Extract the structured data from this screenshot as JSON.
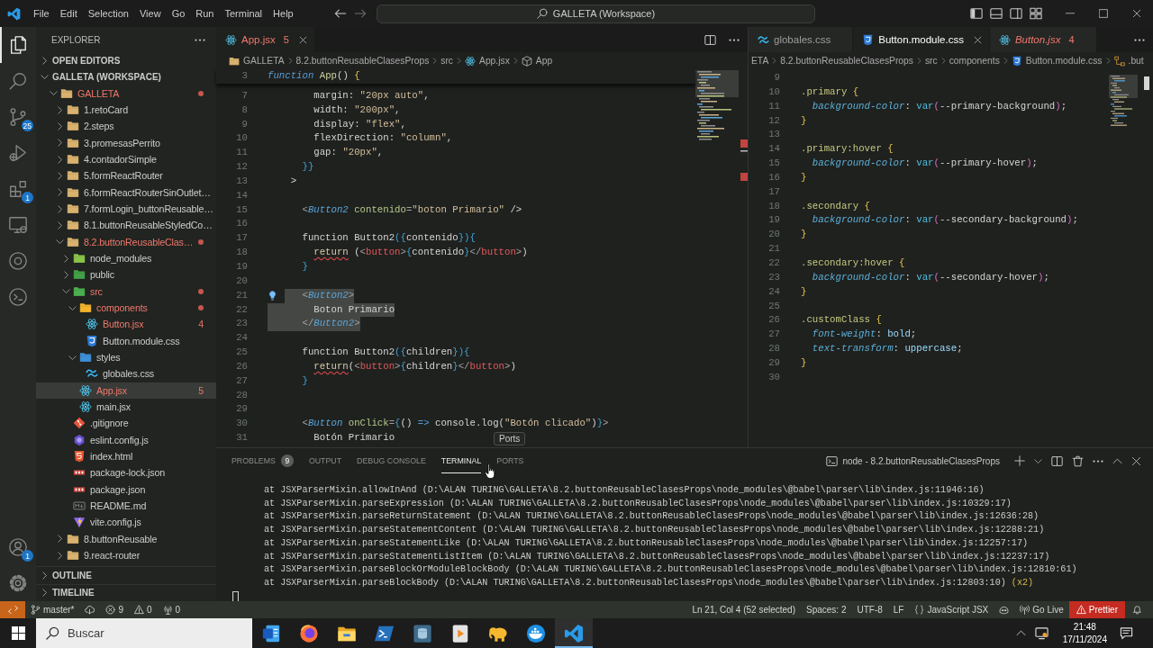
{
  "title_bar": {
    "menus": [
      "File",
      "Edit",
      "Selection",
      "View",
      "Go",
      "Run",
      "Terminal",
      "Help"
    ],
    "search": "GALLETA (Workspace)"
  },
  "activity_bar": {
    "top": [
      {
        "kind": "files",
        "selected": true
      },
      {
        "kind": "search",
        "selected": false
      },
      {
        "kind": "source-control",
        "selected": false,
        "badge": "25"
      },
      {
        "kind": "run-debug",
        "selected": false
      },
      {
        "kind": "extensions",
        "selected": false,
        "badge": "1"
      },
      {
        "kind": "remote",
        "selected": false
      },
      {
        "kind": "target",
        "selected": false
      },
      {
        "kind": "disc",
        "selected": false
      }
    ],
    "bottom": [
      {
        "kind": "account",
        "badge": "1"
      },
      {
        "kind": "settings"
      }
    ]
  },
  "sidebar": {
    "title": "EXPLORER",
    "sections": [
      {
        "label": "OPEN EDITORS",
        "expanded": false
      },
      {
        "label": "GALLETA (WORKSPACE)",
        "expanded": true,
        "tree": [
          {
            "label": "GALLETA",
            "kind": "folder-root",
            "expanded": true,
            "error": true,
            "selected": false,
            "children": [
              {
                "label": "1.retoCard",
                "kind": "folder",
                "expanded": false,
                "error": false,
                "selected": false
              },
              {
                "label": "2.steps",
                "kind": "folder",
                "expanded": false,
                "error": false,
                "selected": false
              },
              {
                "label": "3.promesasPerrito",
                "kind": "folder",
                "expanded": false,
                "error": false,
                "selected": false
              },
              {
                "label": "4.contadorSimple",
                "kind": "folder",
                "expanded": false,
                "error": false,
                "selected": false
              },
              {
                "label": "5.formReactRouter",
                "kind": "folder",
                "expanded": false,
                "error": false,
                "selected": false
              },
              {
                "label": "6.formReactRouterSinOutlet…",
                "kind": "folder",
                "expanded": false,
                "error": false,
                "selected": false
              },
              {
                "label": "7.formLogin_buttonReusable…",
                "kind": "folder",
                "expanded": false,
                "error": false,
                "selected": false
              },
              {
                "label": "8.1.buttonReusableStyledCo…",
                "kind": "folder",
                "expanded": false,
                "error": false,
                "selected": false
              },
              {
                "label": "8.2.buttonReusableClas…",
                "kind": "folder",
                "expanded": true,
                "error": true,
                "selected": false,
                "children": [
                  {
                    "label": "node_modules",
                    "kind": "folder-node",
                    "expanded": false,
                    "error": false,
                    "selected": false
                  },
                  {
                    "label": "public",
                    "kind": "folder-public",
                    "expanded": false,
                    "error": false,
                    "selected": false
                  },
                  {
                    "label": "src",
                    "kind": "folder-src",
                    "expanded": true,
                    "error": true,
                    "selected": false,
                    "children": [
                      {
                        "label": "components",
                        "kind": "folder-components",
                        "expanded": true,
                        "error": true,
                        "selected": false,
                        "children": [
                          {
                            "label": "Button.jsx",
                            "kind": "react",
                            "error": true,
                            "selected": false,
                            "badge": "4"
                          },
                          {
                            "label": "Button.module.css",
                            "kind": "css",
                            "error": false,
                            "selected": false
                          }
                        ]
                      },
                      {
                        "label": "styles",
                        "kind": "folder-styles",
                        "expanded": true,
                        "error": false,
                        "selected": false,
                        "children": [
                          {
                            "label": "globales.css",
                            "kind": "wave",
                            "error": false,
                            "selected": false
                          }
                        ]
                      },
                      {
                        "label": "App.jsx",
                        "kind": "react",
                        "error": true,
                        "selected": true,
                        "badge": "5"
                      },
                      {
                        "label": "main.jsx",
                        "kind": "react",
                        "error": false,
                        "selected": false
                      }
                    ]
                  },
                  {
                    "label": ".gitignore",
                    "kind": "git",
                    "error": false,
                    "selected": false
                  },
                  {
                    "label": "eslint.config.js",
                    "kind": "eslint",
                    "error": false,
                    "selected": false
                  },
                  {
                    "label": "index.html",
                    "kind": "html",
                    "error": false,
                    "selected": false
                  },
                  {
                    "label": "package-lock.json",
                    "kind": "json",
                    "error": false,
                    "selected": false
                  },
                  {
                    "label": "package.json",
                    "kind": "json",
                    "error": false,
                    "selected": false
                  },
                  {
                    "label": "README.md",
                    "kind": "markdown",
                    "error": false,
                    "selected": false
                  },
                  {
                    "label": "vite.config.js",
                    "kind": "vite",
                    "error": false,
                    "selected": false
                  }
                ]
              },
              {
                "label": "8.buttonReusable",
                "kind": "folder",
                "expanded": false,
                "error": false,
                "selected": false
              },
              {
                "label": "9.react-router",
                "kind": "folder",
                "expanded": false,
                "error": false,
                "selected": false
              }
            ]
          }
        ]
      },
      {
        "label": "OUTLINE",
        "expanded": false
      },
      {
        "label": "TIMELINE",
        "expanded": false
      }
    ]
  },
  "editors": [
    {
      "tabs": [
        {
          "label": "App.jsx",
          "kind": "react",
          "badge": "5",
          "error": true,
          "selected": true,
          "preview": false
        }
      ],
      "breadcrumbs": [
        {
          "label": "GALLETA",
          "kind": "folder"
        },
        {
          "label": "8.2.buttonReusableClasesProps",
          "kind": "plain"
        },
        {
          "label": "src",
          "kind": "plain"
        },
        {
          "label": "App.jsx",
          "kind": "react"
        },
        {
          "label": "App",
          "kind": "symbol"
        }
      ],
      "sticky_line": {
        "number": "3",
        "tokens": [
          {
            "kind": "kw",
            "text": "function"
          },
          {
            "kind": "fn",
            "text": " App"
          },
          {
            "kind": "text",
            "text": "() "
          },
          {
            "kind": "ybrace",
            "text": "{"
          }
        ]
      },
      "lines": [
        {
          "number": "7",
          "selected": false,
          "tokens": [
            {
              "kind": "text",
              "text": "        margin: "
            },
            {
              "kind": "str",
              "text": "\"20px auto\""
            },
            {
              "kind": "text",
              "text": ","
            }
          ]
        },
        {
          "number": "8",
          "selected": false,
          "tokens": [
            {
              "kind": "text",
              "text": "        width: "
            },
            {
              "kind": "str",
              "text": "\"200px\""
            },
            {
              "kind": "text",
              "text": ","
            }
          ]
        },
        {
          "number": "9",
          "selected": false,
          "tokens": [
            {
              "kind": "text",
              "text": "        display: "
            },
            {
              "kind": "str",
              "text": "\"flex\""
            },
            {
              "kind": "text",
              "text": ","
            }
          ]
        },
        {
          "number": "10",
          "selected": false,
          "tokens": [
            {
              "kind": "text",
              "text": "        flexDirection: "
            },
            {
              "kind": "str",
              "text": "\"column\""
            },
            {
              "kind": "text",
              "text": ","
            }
          ]
        },
        {
          "number": "11",
          "selected": false,
          "tokens": [
            {
              "kind": "text",
              "text": "        gap: "
            },
            {
              "kind": "str",
              "text": "\"20px\""
            },
            {
              "kind": "text",
              "text": ","
            }
          ]
        },
        {
          "number": "12",
          "selected": false,
          "tokens": [
            {
              "kind": "brace",
              "text": "      }}"
            }
          ]
        },
        {
          "number": "13",
          "selected": false,
          "tokens": [
            {
              "kind": "text",
              "text": "    >"
            }
          ]
        },
        {
          "number": "14",
          "selected": false
        },
        {
          "number": "15",
          "selected": false,
          "tokens": [
            {
              "kind": "punct",
              "text": "      <"
            },
            {
              "kind": "comp",
              "text": "Button2"
            },
            {
              "kind": "attr",
              "text": " contenido"
            },
            {
              "kind": "punct",
              "text": "="
            },
            {
              "kind": "str",
              "text": "\"boton Primario\""
            },
            {
              "kind": "text",
              "text": " />"
            }
          ]
        },
        {
          "number": "16",
          "selected": false
        },
        {
          "number": "17",
          "selected": false,
          "tokens": [
            {
              "kind": "text",
              "text": "      function Button2"
            },
            {
              "kind": "brace",
              "text": "({"
            },
            {
              "kind": "text",
              "text": "contenido"
            },
            {
              "kind": "brace",
              "text": "}){"
            }
          ]
        },
        {
          "number": "18",
          "selected": false,
          "tokens": [
            {
              "kind": "err",
              "text": "        return"
            },
            {
              "kind": "text",
              "text": " ("
            },
            {
              "kind": "punct",
              "text": "<"
            },
            {
              "kind": "tag",
              "text": "button"
            },
            {
              "kind": "punct",
              "text": ">"
            },
            {
              "kind": "brace",
              "text": "{"
            },
            {
              "kind": "text",
              "text": "contenido"
            },
            {
              "kind": "brace",
              "text": "}"
            },
            {
              "kind": "punct",
              "text": "</"
            },
            {
              "kind": "tag",
              "text": "button"
            },
            {
              "kind": "punct",
              "text": ">"
            },
            {
              "kind": "text",
              "text": ")"
            }
          ]
        },
        {
          "number": "19",
          "selected": false,
          "tokens": [
            {
              "kind": "brace",
              "text": "      }"
            }
          ]
        },
        {
          "number": "20",
          "selected": false
        },
        {
          "number": "21",
          "selected": true,
          "tokens": [
            {
              "kind": "punct",
              "text": "      <"
            },
            {
              "kind": "comp",
              "text": "Button2"
            },
            {
              "kind": "punct",
              "text": ">"
            }
          ]
        },
        {
          "number": "22",
          "selected": true,
          "tokens": [
            {
              "kind": "text",
              "text": "        Boton Primario"
            }
          ]
        },
        {
          "number": "23",
          "selected": true,
          "tokens": [
            {
              "kind": "punct",
              "text": "      </"
            },
            {
              "kind": "comp",
              "text": "Button2"
            },
            {
              "kind": "punct",
              "text": ">"
            }
          ]
        },
        {
          "number": "24",
          "selected": false
        },
        {
          "number": "25",
          "selected": false,
          "tokens": [
            {
              "kind": "text",
              "text": "      function Button2"
            },
            {
              "kind": "brace",
              "text": "({"
            },
            {
              "kind": "text",
              "text": "children"
            },
            {
              "kind": "brace",
              "text": "}){"
            }
          ]
        },
        {
          "number": "26",
          "selected": false,
          "tokens": [
            {
              "kind": "err",
              "text": "        return"
            },
            {
              "kind": "text",
              "text": "("
            },
            {
              "kind": "punct",
              "text": "<"
            },
            {
              "kind": "tag",
              "text": "button"
            },
            {
              "kind": "punct",
              "text": ">"
            },
            {
              "kind": "brace",
              "text": "{"
            },
            {
              "kind": "text",
              "text": "children"
            },
            {
              "kind": "brace",
              "text": "}"
            },
            {
              "kind": "punct",
              "text": "</"
            },
            {
              "kind": "tag",
              "text": "button"
            },
            {
              "kind": "punct",
              "text": ">"
            },
            {
              "kind": "text",
              "text": ")"
            }
          ]
        },
        {
          "number": "27",
          "selected": false,
          "tokens": [
            {
              "kind": "brace",
              "text": "      }"
            }
          ]
        },
        {
          "number": "28",
          "selected": false
        },
        {
          "number": "29",
          "selected": false
        },
        {
          "number": "30",
          "selected": false,
          "tokens": [
            {
              "kind": "punct",
              "text": "      <"
            },
            {
              "kind": "comp",
              "text": "Button"
            },
            {
              "kind": "attr",
              "text": " onClick"
            },
            {
              "kind": "punct",
              "text": "="
            },
            {
              "kind": "brace",
              "text": "{"
            },
            {
              "kind": "text",
              "text": "() "
            },
            {
              "kind": "op",
              "text": "=>"
            },
            {
              "kind": "text",
              "text": " console.log("
            },
            {
              "kind": "str",
              "text": "\"Botón clicado\""
            },
            {
              "kind": "text",
              "text": ")"
            },
            {
              "kind": "brace",
              "text": "}"
            },
            {
              "kind": "punct",
              "text": ">"
            }
          ]
        },
        {
          "number": "31",
          "selected": false,
          "tokens": [
            {
              "kind": "text",
              "text": "        Botón Primario"
            }
          ]
        }
      ]
    },
    {
      "tabs": [
        {
          "label": "globales.css",
          "kind": "wave",
          "error": false,
          "selected": false,
          "preview": false
        },
        {
          "label": "Button.module.css",
          "kind": "css",
          "error": false,
          "selected": true,
          "preview": false
        },
        {
          "label": "Button.jsx",
          "kind": "react",
          "badge": "4",
          "error": true,
          "selected": false,
          "preview": true
        }
      ],
      "breadcrumbs": [
        {
          "label": "ETA",
          "kind": "plain"
        },
        {
          "label": "8.2.buttonReusableClasesProps",
          "kind": "plain"
        },
        {
          "label": "src",
          "kind": "plain"
        },
        {
          "label": "components",
          "kind": "plain"
        },
        {
          "label": "Button.module.css",
          "kind": "css"
        },
        {
          "label": ".but",
          "kind": "selector"
        }
      ],
      "lines": [
        {
          "number": "9"
        },
        {
          "number": "10",
          "tokens": [
            {
              "kind": "sel",
              "text": ".primary"
            },
            {
              "kind": "ybrace",
              "text": " {"
            }
          ]
        },
        {
          "number": "11",
          "tokens": [
            {
              "kind": "prop",
              "text": "  background-color"
            },
            {
              "kind": "text",
              "text": ": "
            },
            {
              "kind": "fn2",
              "text": "var"
            },
            {
              "kind": "paren",
              "text": "("
            },
            {
              "kind": "text",
              "text": "--primary-background"
            },
            {
              "kind": "paren",
              "text": ")"
            },
            {
              "kind": "text",
              "text": ";"
            }
          ]
        },
        {
          "number": "12",
          "tokens": [
            {
              "kind": "ybrace",
              "text": "}"
            }
          ]
        },
        {
          "number": "13"
        },
        {
          "number": "14",
          "tokens": [
            {
              "kind": "sel",
              "text": ".primary:hover"
            },
            {
              "kind": "ybrace",
              "text": " {"
            }
          ]
        },
        {
          "number": "15",
          "tokens": [
            {
              "kind": "prop",
              "text": "  background-color"
            },
            {
              "kind": "text",
              "text": ": "
            },
            {
              "kind": "fn2",
              "text": "var"
            },
            {
              "kind": "paren",
              "text": "("
            },
            {
              "kind": "text",
              "text": "--primary-hover"
            },
            {
              "kind": "paren",
              "text": ")"
            },
            {
              "kind": "text",
              "text": ";"
            }
          ]
        },
        {
          "number": "16",
          "tokens": [
            {
              "kind": "ybrace",
              "text": "}"
            }
          ]
        },
        {
          "number": "17"
        },
        {
          "number": "18",
          "tokens": [
            {
              "kind": "sel",
              "text": ".secondary"
            },
            {
              "kind": "ybrace",
              "text": " {"
            }
          ]
        },
        {
          "number": "19",
          "tokens": [
            {
              "kind": "prop",
              "text": "  background-color"
            },
            {
              "kind": "text",
              "text": ": "
            },
            {
              "kind": "fn2",
              "text": "var"
            },
            {
              "kind": "paren",
              "text": "("
            },
            {
              "kind": "text",
              "text": "--secondary-background"
            },
            {
              "kind": "paren",
              "text": ")"
            },
            {
              "kind": "text",
              "text": ";"
            }
          ]
        },
        {
          "number": "20",
          "tokens": [
            {
              "kind": "ybrace",
              "text": "}"
            }
          ]
        },
        {
          "number": "21"
        },
        {
          "number": "22",
          "tokens": [
            {
              "kind": "sel",
              "text": ".secondary:hover"
            },
            {
              "kind": "ybrace",
              "text": " {"
            }
          ]
        },
        {
          "number": "23",
          "tokens": [
            {
              "kind": "prop",
              "text": "  background-color"
            },
            {
              "kind": "text",
              "text": ": "
            },
            {
              "kind": "fn2",
              "text": "var"
            },
            {
              "kind": "paren",
              "text": "("
            },
            {
              "kind": "text",
              "text": "--secondary-hover"
            },
            {
              "kind": "paren",
              "text": ")"
            },
            {
              "kind": "text",
              "text": ";"
            }
          ]
        },
        {
          "number": "24",
          "tokens": [
            {
              "kind": "ybrace",
              "text": "}"
            }
          ]
        },
        {
          "number": "25"
        },
        {
          "number": "26",
          "tokens": [
            {
              "kind": "sel",
              "text": ".customClass"
            },
            {
              "kind": "ybrace",
              "text": " {"
            }
          ]
        },
        {
          "number": "27",
          "tokens": [
            {
              "kind": "prop",
              "text": "  font-weight"
            },
            {
              "kind": "text",
              "text": ": "
            },
            {
              "kind": "val",
              "text": "bold"
            },
            {
              "kind": "text",
              "text": ";"
            }
          ]
        },
        {
          "number": "28",
          "tokens": [
            {
              "kind": "prop",
              "text": "  text-transform"
            },
            {
              "kind": "text",
              "text": ": "
            },
            {
              "kind": "val",
              "text": "uppercase"
            },
            {
              "kind": "text",
              "text": ";"
            }
          ]
        },
        {
          "number": "29",
          "tokens": [
            {
              "kind": "ybrace",
              "text": "}"
            }
          ]
        },
        {
          "number": "30"
        }
      ]
    }
  ],
  "panel": {
    "tabs": [
      {
        "label": "PROBLEMS",
        "badge": "9",
        "selected": false
      },
      {
        "label": "OUTPUT",
        "selected": false
      },
      {
        "label": "DEBUG CONSOLE",
        "selected": false
      },
      {
        "label": "TERMINAL",
        "selected": true
      },
      {
        "label": "PORTS",
        "selected": false
      }
    ],
    "tooltip": "Ports",
    "terminal": {
      "name": "node - 8.2.buttonReusableClasesProps",
      "lines": [
        {
          "text": "at JSXParserMixin.allowInAnd (D:\\ALAN TURING\\GALLETA\\8.2.buttonReusableClasesProps\\node_modules\\@babel\\parser\\lib\\index.js:11946:16)"
        },
        {
          "text": "at JSXParserMixin.parseExpression (D:\\ALAN TURING\\GALLETA\\8.2.buttonReusableClasesProps\\node_modules\\@babel\\parser\\lib\\index.js:10329:17)"
        },
        {
          "text": "at JSXParserMixin.parseReturnStatement (D:\\ALAN TURING\\GALLETA\\8.2.buttonReusableClasesProps\\node_modules\\@babel\\parser\\lib\\index.js:12636:28)"
        },
        {
          "text": "at JSXParserMixin.parseStatementContent (D:\\ALAN TURING\\GALLETA\\8.2.buttonReusableClasesProps\\node_modules\\@babel\\parser\\lib\\index.js:12288:21)"
        },
        {
          "text": "at JSXParserMixin.parseStatementLike (D:\\ALAN TURING\\GALLETA\\8.2.buttonReusableClasesProps\\node_modules\\@babel\\parser\\lib\\index.js:12257:17)"
        },
        {
          "text": "at JSXParserMixin.parseStatementListItem (D:\\ALAN TURING\\GALLETA\\8.2.buttonReusableClasesProps\\node_modules\\@babel\\parser\\lib\\index.js:12237:17)"
        },
        {
          "text": "at JSXParserMixin.parseBlockOrModuleBlockBody (D:\\ALAN TURING\\GALLETA\\8.2.buttonReusableClasesProps\\node_modules\\@babel\\parser\\lib\\index.js:12810:61)"
        },
        {
          "text": "at JSXParserMixin.parseBlockBody (D:\\ALAN TURING\\GALLETA\\8.2.buttonReusableClasesProps\\node_modules\\@babel\\parser\\lib\\index.js:12803:10)",
          "count": "(x2)"
        }
      ]
    }
  },
  "status_bar": {
    "left": [
      {
        "kind": "remote"
      },
      {
        "kind": "branch",
        "label": "master*"
      },
      {
        "kind": "sync"
      },
      {
        "kind": "errors",
        "label": "9"
      },
      {
        "kind": "warnings",
        "label": "0"
      },
      {
        "kind": "ports",
        "label": "0"
      }
    ],
    "right": [
      {
        "kind": "text",
        "label": "Ln 21, Col 4 (52 selected)"
      },
      {
        "kind": "text",
        "label": "Spaces: 2"
      },
      {
        "kind": "text",
        "label": "UTF-8"
      },
      {
        "kind": "text",
        "label": "LF"
      },
      {
        "kind": "language",
        "label": "JavaScript JSX"
      },
      {
        "kind": "assistant"
      },
      {
        "kind": "live",
        "label": "Go Live"
      },
      {
        "kind": "alert",
        "label": "Prettier"
      },
      {
        "kind": "bell"
      }
    ]
  },
  "taskbar": {
    "search": {
      "placeholder": "Buscar"
    },
    "apps": [
      {
        "kind": "document",
        "selected": false
      },
      {
        "kind": "globe",
        "selected": false
      },
      {
        "kind": "folder",
        "selected": false
      },
      {
        "kind": "terminal",
        "selected": false
      },
      {
        "kind": "database",
        "selected": false
      },
      {
        "kind": "media",
        "selected": false
      },
      {
        "kind": "elephant",
        "selected": false
      },
      {
        "kind": "whale",
        "selected": false
      },
      {
        "kind": "code",
        "selected": true
      }
    ],
    "time": "21:48",
    "date": "17/11/2024"
  }
}
